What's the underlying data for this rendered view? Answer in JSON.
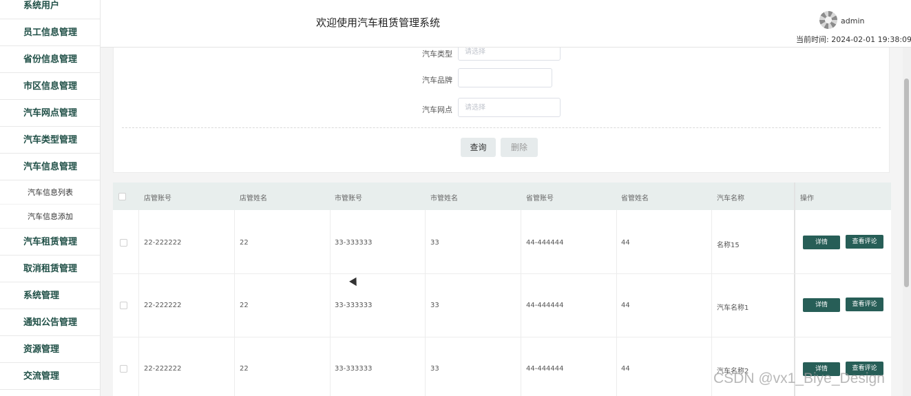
{
  "sidebar": {
    "items": [
      {
        "label": "系统用户"
      },
      {
        "label": "员工信息管理"
      },
      {
        "label": "省份信息管理"
      },
      {
        "label": "市区信息管理"
      },
      {
        "label": "汽车网点管理"
      },
      {
        "label": "汽车类型管理"
      },
      {
        "label": "汽车信息管理"
      },
      {
        "label": "汽车信息列表"
      },
      {
        "label": "汽车信息添加"
      },
      {
        "label": "汽车租赁管理"
      },
      {
        "label": "取消租赁管理"
      },
      {
        "label": "系统管理"
      },
      {
        "label": "通知公告管理"
      },
      {
        "label": "资源管理"
      },
      {
        "label": "交流管理"
      }
    ]
  },
  "header": {
    "title": "欢迎使用汽车租赁管理系统",
    "username": "admin",
    "time_label": "当前时间:",
    "time_value": "2024-02-01 19:38:09"
  },
  "search": {
    "type_label": "汽车类型",
    "type_placeholder": "请选择",
    "brand_label": "汽车品牌",
    "brand_value": "",
    "outlet_label": "汽车网点",
    "outlet_placeholder": "请选择",
    "query_button": "查询",
    "delete_button": "删除"
  },
  "table": {
    "columns": [
      "店管账号",
      "店管姓名",
      "市管账号",
      "市管姓名",
      "省管账号",
      "省管姓名",
      "汽车名称",
      "操作"
    ],
    "rows": [
      [
        "22-222222",
        "22",
        "33-333333",
        "33",
        "44-444444",
        "44",
        "名称15"
      ],
      [
        "22-222222",
        "22",
        "33-333333",
        "33",
        "44-444444",
        "44",
        "汽车名称1"
      ],
      [
        "22-222222",
        "22",
        "33-333333",
        "33",
        "44-444444",
        "44",
        "汽车名称2"
      ]
    ],
    "detail_button": "详情",
    "review_button": "查看评论"
  },
  "watermark": "CSDN @vx1_Biye_Design",
  "colors": {
    "accent": "#275e57",
    "menu_text": "#1f4f46",
    "table_header_bg": "#e8eeed"
  }
}
